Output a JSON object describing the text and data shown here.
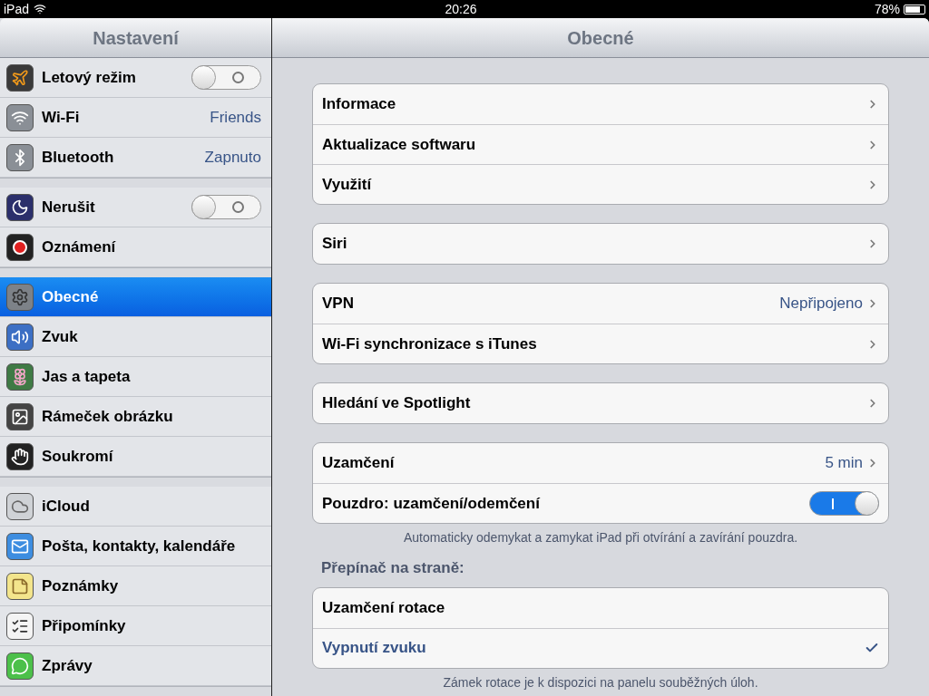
{
  "status_bar": {
    "device": "iPad",
    "time": "20:26",
    "battery": "78%"
  },
  "sidebar": {
    "title": "Nastavení",
    "groups": [
      {
        "items": [
          {
            "label": "Letový režim",
            "kind": "toggle",
            "on": false,
            "selected": false
          },
          {
            "label": "Wi-Fi",
            "kind": "value",
            "value": "Friends",
            "selected": false
          },
          {
            "label": "Bluetooth",
            "kind": "value",
            "value": "Zapnuto",
            "selected": false
          }
        ]
      },
      {
        "items": [
          {
            "label": "Nerušit",
            "kind": "toggle",
            "on": false,
            "selected": false
          },
          {
            "label": "Oznámení",
            "kind": "plain",
            "selected": false
          }
        ]
      },
      {
        "items": [
          {
            "label": "Obecné",
            "kind": "plain",
            "selected": true
          },
          {
            "label": "Zvuk",
            "kind": "plain",
            "selected": false
          },
          {
            "label": "Jas a tapeta",
            "kind": "plain",
            "selected": false
          },
          {
            "label": "Rámeček obrázku",
            "kind": "plain",
            "selected": false
          },
          {
            "label": "Soukromí",
            "kind": "plain",
            "selected": false
          }
        ]
      },
      {
        "items": [
          {
            "label": "iCloud",
            "kind": "plain",
            "selected": false
          },
          {
            "label": "Pošta, kontakty, kalendáře",
            "kind": "plain",
            "selected": false
          },
          {
            "label": "Poznámky",
            "kind": "plain",
            "selected": false
          },
          {
            "label": "Připomínky",
            "kind": "plain",
            "selected": false
          },
          {
            "label": "Zprávy",
            "kind": "plain",
            "selected": false
          }
        ]
      }
    ]
  },
  "detail": {
    "title": "Obecné",
    "groups": [
      {
        "rows": [
          {
            "label": "Informace",
            "kind": "nav"
          },
          {
            "label": "Aktualizace softwaru",
            "kind": "nav"
          },
          {
            "label": "Využití",
            "kind": "nav"
          }
        ]
      },
      {
        "rows": [
          {
            "label": "Siri",
            "kind": "nav"
          }
        ]
      },
      {
        "rows": [
          {
            "label": "VPN",
            "kind": "nav",
            "value": "Nepřipojeno"
          },
          {
            "label": "Wi-Fi synchronizace s iTunes",
            "kind": "nav"
          }
        ]
      },
      {
        "rows": [
          {
            "label": "Hledání ve Spotlight",
            "kind": "nav"
          }
        ]
      },
      {
        "rows": [
          {
            "label": "Uzamčení",
            "kind": "nav",
            "value": "5 min"
          },
          {
            "label": "Pouzdro: uzamčení/odemčení",
            "kind": "toggle",
            "on": true
          }
        ],
        "footer": "Automaticky odemykat a zamykat iPad při otvírání a zavírání pouzdra."
      },
      {
        "header": "Přepínač na straně:",
        "rows": [
          {
            "label": "Uzamčení rotace",
            "kind": "choice",
            "selected": false
          },
          {
            "label": "Vypnutí zvuku",
            "kind": "choice",
            "selected": true
          }
        ],
        "footer": "Zámek rotace je k dispozici na panelu souběžných úloh."
      }
    ]
  }
}
